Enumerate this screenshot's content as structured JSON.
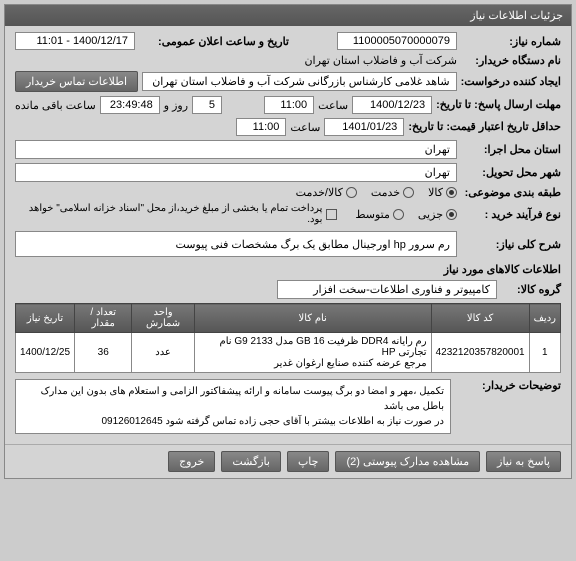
{
  "header": {
    "title": "جزئیات اطلاعات نیاز"
  },
  "fields": {
    "need_number_label": "شماره نیاز:",
    "need_number": "1100005070000079",
    "public_announce_label": "تاریخ و ساعت اعلان عمومی:",
    "public_announce": "1400/12/17 - 11:01",
    "buyer_org_label": "نام دستگاه خریدار:",
    "buyer_org": "شرکت آب و فاضلاب استان تهران",
    "requester_label": "ایجاد کننده درخواست:",
    "requester": "شاهد غلامی کارشناس بازرگانی شرکت آب و فاضلاب استان تهران",
    "contact_btn": "اطلاعات تماس خریدار",
    "submit_deadline_label": "مهلت ارسال پاسخ: تا تاریخ:",
    "submit_deadline_date": "1400/12/23",
    "saat": "ساعت",
    "submit_deadline_time": "11:00",
    "days_label": "روز و",
    "days_value": "5",
    "remaining_label": "ساعت باقی مانده",
    "remaining_time": "23:49:48",
    "min_validity_label": "حداقل تاریخ اعتبار قیمت: تا تاریخ:",
    "min_validity_date": "1401/01/23",
    "min_validity_time": "11:00",
    "exec_city_label": "استان محل اجرا:",
    "exec_city": "تهران",
    "delivery_city_label": "شهر محل تحویل:",
    "delivery_city": "تهران",
    "category_label": "طبقه بندی موضوعی:",
    "cat_goods": "کالا",
    "cat_service": "خدمت",
    "cat_both": "کالا/خدمت",
    "purchase_type_label": "نوع فرآیند خرید :",
    "pt_small": "جزیی",
    "pt_medium": "متوسط",
    "payment_note": "پرداخت تمام یا بخشی از مبلغ خرید،از محل \"اسناد خزانه اسلامی\" خواهد بود.",
    "need_desc_label": "شرح کلی نیاز:",
    "need_desc": "رم سرور hp اورجینال مطابق یک برگ مشخصات فنی پیوست",
    "needed_items_title": "اطلاعات کالاهای مورد نیاز",
    "group_label": "گروه کالا:",
    "group_value": "کامپیوتر و فناوری اطلاعات-سخت افزار",
    "buyer_notes_label": "توضیحات خریدار:",
    "buyer_notes_line1": "تکمیل ،مهر و امضا دو برگ پیوست سامانه و ارائه پیشفاکتور الزامی و استعلام های بدون این مدارک باطل می باشد",
    "buyer_notes_line2": "در صورت نیاز به اطلاعات بیشتر با آقای حجی زاده تماس گرفته شود 09126012645"
  },
  "table": {
    "headers": {
      "row": "ردیف",
      "code": "کد کالا",
      "name": "نام کالا",
      "unit": "واحد شمارش",
      "qty": "تعداد / مقدار",
      "date": "تاریخ نیاز"
    },
    "rows": [
      {
        "row": "1",
        "code": "4232120357820001",
        "name_line1": "رم رایانه DDR4 ظرفیت GB 16 مدل G9 2133 نام تجارتی HP",
        "name_line2": "مرجع عرضه کننده صنایع ارغوان غدیر",
        "unit": "عدد",
        "qty": "36",
        "date": "1400/12/25"
      }
    ]
  },
  "buttons": {
    "reply": "پاسخ به نیاز",
    "attachments": "مشاهده مدارک پیوستی (2)",
    "print": "چاپ",
    "back": "بازگشت",
    "exit": "خروج"
  }
}
